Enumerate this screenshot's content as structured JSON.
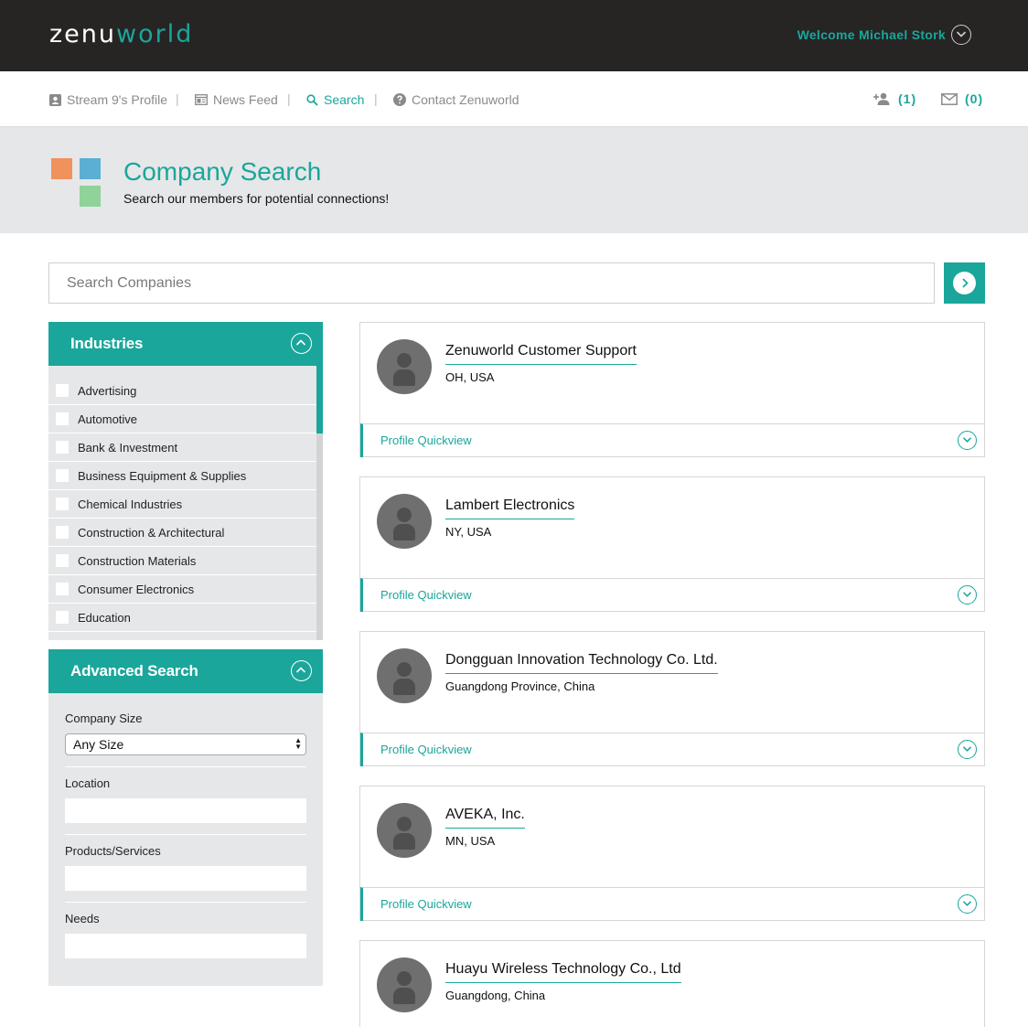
{
  "header": {
    "logo_part1": "zenu",
    "logo_part2": "world",
    "welcome": "Welcome Michael Stork"
  },
  "nav": {
    "items": [
      {
        "label": "Stream 9's Profile",
        "icon": "profile-card-icon"
      },
      {
        "label": "News Feed",
        "icon": "newspaper-icon"
      },
      {
        "label": "Search",
        "icon": "search-icon",
        "active": true
      },
      {
        "label": "Contact Zenuworld",
        "icon": "help-icon"
      }
    ],
    "separator": "|",
    "connections_count": "(1)",
    "messages_count": "(0)"
  },
  "hero": {
    "title": "Company Search",
    "subtitle": "Search our members for potential connections!"
  },
  "search": {
    "placeholder": "Search Companies"
  },
  "industries": {
    "title": "Industries",
    "items": [
      "Advertising",
      "Automotive",
      "Bank & Investment",
      "Business Equipment & Supplies",
      "Chemical Industries",
      "Construction & Architectural",
      "Construction Materials",
      "Consumer Electronics",
      "Education"
    ]
  },
  "advanced": {
    "title": "Advanced Search",
    "company_size_label": "Company Size",
    "company_size_value": "Any Size",
    "location_label": "Location",
    "products_label": "Products/Services",
    "needs_label": "Needs"
  },
  "results": [
    {
      "name": "Zenuworld Customer Support",
      "location": "OH, USA",
      "quickview": "Profile Quickview"
    },
    {
      "name": "Lambert Electronics",
      "location": "NY, USA",
      "quickview": "Profile Quickview"
    },
    {
      "name": "Dongguan Innovation Technology Co. Ltd.",
      "location": "Guangdong Province, China",
      "quickview": "Profile Quickview"
    },
    {
      "name": "AVEKA, Inc.",
      "location": "MN, USA",
      "quickview": "Profile Quickview"
    },
    {
      "name": "Huayu Wireless Technology Co., Ltd",
      "location": "Guangdong, China"
    }
  ],
  "colors": {
    "accent": "#1aa69b",
    "topbar": "#272424",
    "panel_bg": "#e6e7e8",
    "logo_orange": "#f0925c",
    "logo_blue": "#5aafd3",
    "logo_green": "#8fd29a"
  }
}
